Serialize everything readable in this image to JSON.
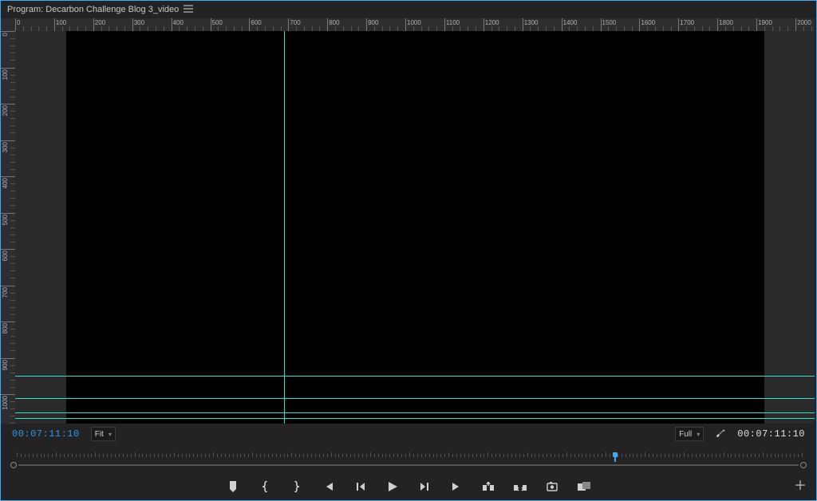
{
  "titlebar": {
    "label": "Program: Decarbon Challenge Blog 3_video"
  },
  "viewer": {
    "ruler": {
      "start": 0,
      "end": 2000,
      "major_step": 100,
      "minor_per_major": 5,
      "pixels_per_unit": 0.489
    },
    "vruler": {
      "start": 0,
      "end": 1080,
      "major_step": 100,
      "minor_per_major": 5,
      "pixels_per_unit": 0.455
    },
    "canvas_dark_left_offset_units": 130,
    "canvas_dark_right_offset_units": 1920,
    "guides": {
      "vertical_units": [
        690
      ],
      "horizontal_units": [
        950,
        1010,
        1050,
        1065
      ]
    }
  },
  "infobar": {
    "timecode_in": "00:07:11:10",
    "zoom_label": "Fit",
    "resolution_label": "Full",
    "timecode_out": "00:07:11:10"
  },
  "scrub": {
    "position_fraction": 0.762
  },
  "transport_icons": [
    "marker",
    "brace-open",
    "brace-close",
    "go-to-in",
    "step-back",
    "play",
    "step-forward",
    "go-to-out",
    "lift",
    "extract",
    "export-frame",
    "safe-margins"
  ]
}
